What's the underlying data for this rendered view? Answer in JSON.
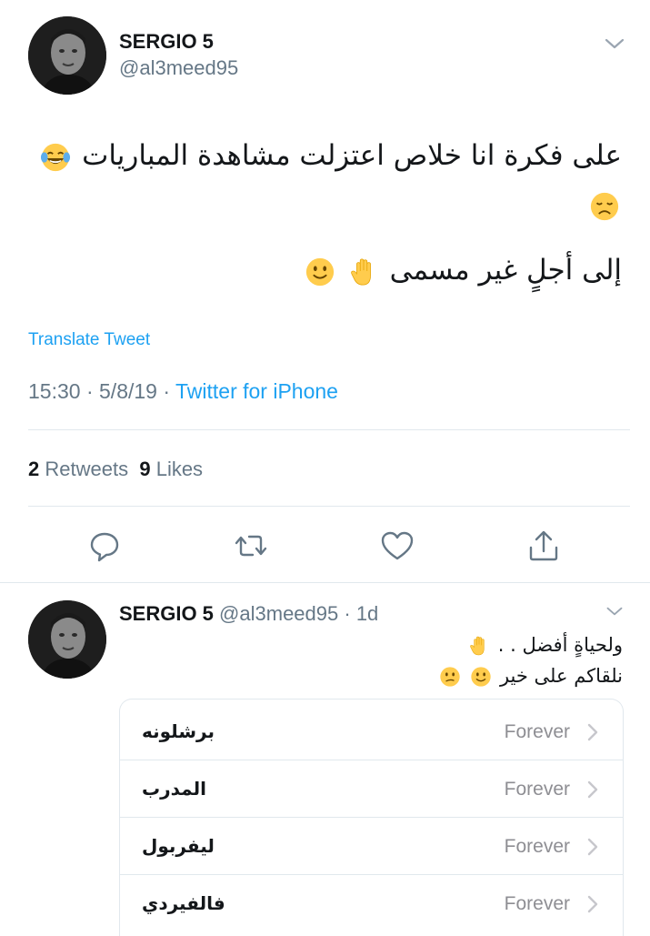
{
  "tweet": {
    "display_name": "SERGIO 5",
    "handle": "@al3meed95",
    "line1_text": "على فكرة انا خلاص اعتزلت مشاهدة المباريات",
    "line1_emojis": [
      "joy-emoji",
      "disappointed-emoji"
    ],
    "line2_text": "إلى أجلٍ غير مسمى",
    "line2_emojis": [
      "raised-hand-emoji",
      "slightly-smiling-emoji"
    ],
    "translate_label": "Translate Tweet",
    "time": "15:30",
    "date": "5/8/19",
    "source": "Twitter for iPhone",
    "retweets_count": "2",
    "retweets_label": "Retweets",
    "likes_count": "9",
    "likes_label": "Likes",
    "actions": [
      "reply-icon",
      "retweet-icon",
      "like-icon",
      "share-icon"
    ]
  },
  "reply": {
    "display_name": "SERGIO 5",
    "handle": "@al3meed95",
    "age": "1d",
    "line1_text": "ولحياةٍ أفضل . .",
    "line2_text": "نلقاكم على خير",
    "card_rows": [
      {
        "label": "برشلونه",
        "value": "Forever"
      },
      {
        "label": "المدرب",
        "value": "Forever"
      },
      {
        "label": "ليفربول",
        "value": "Forever"
      },
      {
        "label": "فالفيردي",
        "value": "Forever"
      }
    ]
  },
  "colors": {
    "link_blue": "#1da1f2",
    "secondary_gray": "#657786",
    "divider": "#e1e8ed",
    "emoji_yellow": "#ffcc4d"
  }
}
